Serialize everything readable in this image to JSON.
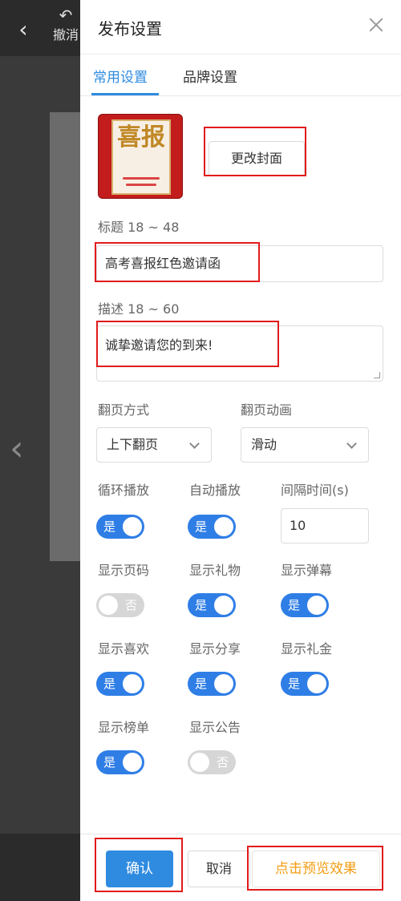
{
  "background": {
    "back_icon": "chevron-left-icon",
    "undo_label": "撤消",
    "undo_icon": "undo-icon"
  },
  "panel": {
    "title": "发布设置",
    "close_icon": "close-icon"
  },
  "tabs": [
    {
      "label": "常用设置",
      "active": true
    },
    {
      "label": "品牌设置",
      "active": false
    }
  ],
  "cover": {
    "image_text": "喜报",
    "change_button": "更改封面"
  },
  "title_field": {
    "label": "标题 18 ~ 48",
    "value": "高考喜报红色邀请函"
  },
  "desc_field": {
    "label": "描述 18 ~ 60",
    "value": "诚挚邀请您的到来!"
  },
  "page_turn": {
    "label": "翻页方式",
    "selected": "上下翻页"
  },
  "page_anim": {
    "label": "翻页动画",
    "selected": "滑动"
  },
  "interval": {
    "label": "间隔时间(s)",
    "value": "10"
  },
  "toggles": [
    {
      "label": "循环播放",
      "on": true,
      "state_text": "是"
    },
    {
      "label": "自动播放",
      "on": true,
      "state_text": "是"
    },
    {
      "label": "显示页码",
      "on": false,
      "state_text": "否"
    },
    {
      "label": "显示礼物",
      "on": true,
      "state_text": "是"
    },
    {
      "label": "显示弹幕",
      "on": true,
      "state_text": "是"
    },
    {
      "label": "显示喜欢",
      "on": true,
      "state_text": "是"
    },
    {
      "label": "显示分享",
      "on": true,
      "state_text": "是"
    },
    {
      "label": "显示礼金",
      "on": true,
      "state_text": "是"
    },
    {
      "label": "显示榜单",
      "on": true,
      "state_text": "是"
    },
    {
      "label": "显示公告",
      "on": false,
      "state_text": "否"
    }
  ],
  "footer": {
    "confirm": "确认",
    "cancel": "取消",
    "preview": "点击预览效果"
  },
  "colors": {
    "accent": "#2f8be0",
    "toggle_on": "#2f7ee6",
    "toggle_off": "#d6d6d6",
    "highlight_box": "#e11b1b",
    "preview_text": "#f39c12"
  }
}
